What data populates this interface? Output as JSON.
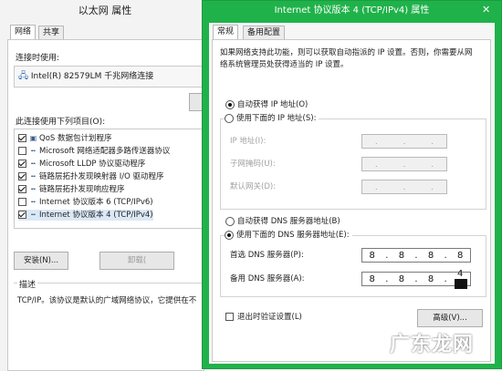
{
  "back_window": {
    "title": "以太网 属性",
    "tabs": [
      "网络",
      "共享"
    ],
    "connect_using_label": "连接时使用:",
    "adapter_name": "Intel(R) 82579LM 千兆网络连接",
    "items_label": "此连接使用下列项目(O):",
    "items": [
      {
        "label": "QoS 数据包计划程序",
        "checked": true,
        "icon": "qos-icon"
      },
      {
        "label": "Microsoft 网络适配器多路传送器协议",
        "checked": false,
        "icon": "protocol-icon"
      },
      {
        "label": "Microsoft LLDP 协议驱动程序",
        "checked": true,
        "icon": "protocol-icon"
      },
      {
        "label": "链路层拓扑发现映射器 I/O 驱动程序",
        "checked": true,
        "icon": "protocol-icon"
      },
      {
        "label": "链路层拓扑发现响应程序",
        "checked": true,
        "icon": "protocol-icon"
      },
      {
        "label": "Internet 协议版本 6 (TCP/IPv6)",
        "checked": false,
        "icon": "protocol-icon"
      },
      {
        "label": "Internet 协议版本 4 (TCP/IPv4)",
        "checked": true,
        "icon": "protocol-icon"
      }
    ],
    "install_button": "安装(N)...",
    "uninstall_button": "卸载(",
    "description_label": "描述",
    "description_text": "TCP/IP。该协议是默认的广域网络协议，它提供在不"
  },
  "front_window": {
    "title": "Internet 协议版本 4 (TCP/IPv4) 属性",
    "tabs": [
      "常规",
      "备用配置"
    ],
    "intro_line1": "如果网络支持此功能，则可以获取自动指派的 IP 设置。否则，你需要从网",
    "intro_line2": "络系统管理员处获得适当的 IP 设置。",
    "auto_ip_label": "自动获得 IP 地址(O)",
    "manual_ip_label": "使用下面的 IP 地址(S):",
    "ip_address_label": "IP 地址(I):",
    "subnet_label": "子网掩码(U):",
    "gateway_label": "默认网关(D):",
    "auto_dns_label": "自动获得 DNS 服务器地址(B)",
    "manual_dns_label": "使用下面的 DNS 服务器地址(E):",
    "preferred_dns_label": "首选 DNS 服务器(P):",
    "preferred_dns": [
      "8",
      "8",
      "8",
      "8"
    ],
    "alternate_dns_label": "备用 DNS 服务器(A):",
    "alternate_dns": [
      "8",
      "8",
      "8",
      "4"
    ],
    "validate_label": "退出时验证设置(L)",
    "advanced_button": "高级(V)...",
    "selected_ip_mode": "auto",
    "selected_dns_mode": "manual",
    "accent_color": "#20b24a"
  },
  "watermark": "广东龙网"
}
